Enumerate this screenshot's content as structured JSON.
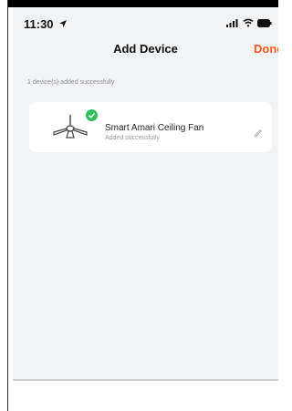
{
  "status_bar": {
    "time": "11:30"
  },
  "nav": {
    "title": "Add Device",
    "done_label": "Done"
  },
  "summary": {
    "text": "1 device(s) added successfully"
  },
  "devices": [
    {
      "name": "Smart Amari Ceiling Fan",
      "status": "Added successfully",
      "icon": "ceiling-fan-icon"
    }
  ],
  "colors": {
    "accent": "#ff5a1f",
    "success": "#2fbf5b",
    "background": "#f2f3f5"
  }
}
